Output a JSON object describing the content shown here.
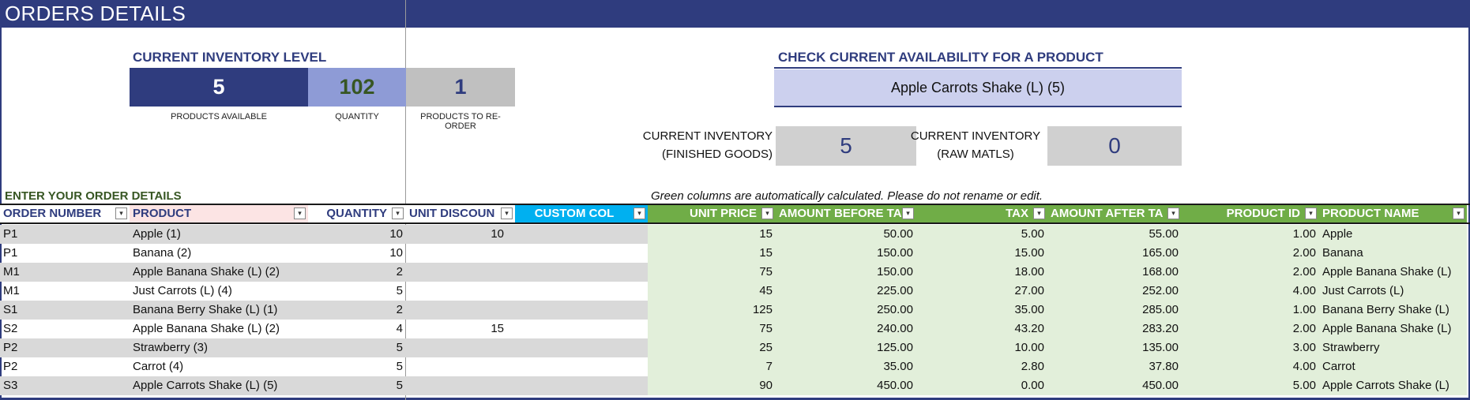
{
  "sheet": {
    "title": "ORDERS DETAILS"
  },
  "inventory": {
    "section_title": "CURRENT INVENTORY LEVEL",
    "products_available": "5",
    "products_available_label": "PRODUCTS AVAILABLE",
    "quantity": "102",
    "quantity_label": "QUANTITY",
    "reorder": "1",
    "reorder_label": "PRODUCTS TO RE-ORDER"
  },
  "availability": {
    "section_title": "CHECK CURRENT AVAILABILITY FOR A PRODUCT",
    "selected_product": "Apple Carrots Shake (L) (5)",
    "finished_label_1": "CURRENT INVENTORY",
    "finished_label_2": "(FINISHED GOODS)",
    "finished_value": "5",
    "raw_label_1": "CURRENT INVENTORY",
    "raw_label_2": "(RAW MATLS)",
    "raw_value": "0"
  },
  "orders": {
    "enter_label": "ENTER YOUR  ORDER DETAILS",
    "note": "Green columns are automatically calculated. Please do not rename or edit.",
    "columns": [
      "ORDER NUMBER",
      "PRODUCT",
      "QUANTITY",
      "UNIT DISCOUN",
      "CUSTOM COL",
      "UNIT PRICE",
      "AMOUNT BEFORE TA",
      "TAX",
      "AMOUNT AFTER TA",
      "PRODUCT ID",
      "PRODUCT NAME"
    ],
    "dropdown_glyph": "▾",
    "rows": [
      [
        "P1",
        "Apple (1)",
        "10",
        "10",
        "",
        "15",
        "50.00",
        "5.00",
        "55.00",
        "1.00",
        "Apple"
      ],
      [
        "P1",
        "Banana (2)",
        "10",
        "",
        "",
        "15",
        "150.00",
        "15.00",
        "165.00",
        "2.00",
        "Banana"
      ],
      [
        "M1",
        "Apple Banana Shake (L) (2)",
        "2",
        "",
        "",
        "75",
        "150.00",
        "18.00",
        "168.00",
        "2.00",
        "Apple Banana Shake (L)"
      ],
      [
        "M1",
        "Just Carrots (L) (4)",
        "5",
        "",
        "",
        "45",
        "225.00",
        "27.00",
        "252.00",
        "4.00",
        "Just Carrots (L)"
      ],
      [
        "S1",
        "Banana Berry Shake (L) (1)",
        "2",
        "",
        "",
        "125",
        "250.00",
        "35.00",
        "285.00",
        "1.00",
        "Banana Berry Shake (L)"
      ],
      [
        "S2",
        "Apple Banana Shake (L) (2)",
        "4",
        "15",
        "",
        "75",
        "240.00",
        "43.20",
        "283.20",
        "2.00",
        "Apple Banana Shake (L)"
      ],
      [
        "P2",
        "Strawberry (3)",
        "5",
        "",
        "",
        "25",
        "125.00",
        "10.00",
        "135.00",
        "3.00",
        "Strawberry"
      ],
      [
        "P2",
        "Carrot (4)",
        "5",
        "",
        "",
        "7",
        "35.00",
        "2.80",
        "37.80",
        "4.00",
        "Carrot"
      ],
      [
        "S3",
        "Apple Carrots Shake (L) (5)",
        "5",
        "",
        "",
        "90",
        "450.00",
        "0.00",
        "450.00",
        "5.00",
        "Apple Carrots Shake (L)"
      ]
    ]
  },
  "colors": {
    "header_blue": "#2f3c7e",
    "kpi_dark": "#2f3c7e",
    "kpi_light": "#8e9bd6",
    "kpi_grey": "#c0c0c0",
    "green_header": "#70ad47",
    "green_fill": "#e2efda",
    "custom_col_blue": "#00b0f0",
    "product_header_pink": "#fce4e4"
  }
}
